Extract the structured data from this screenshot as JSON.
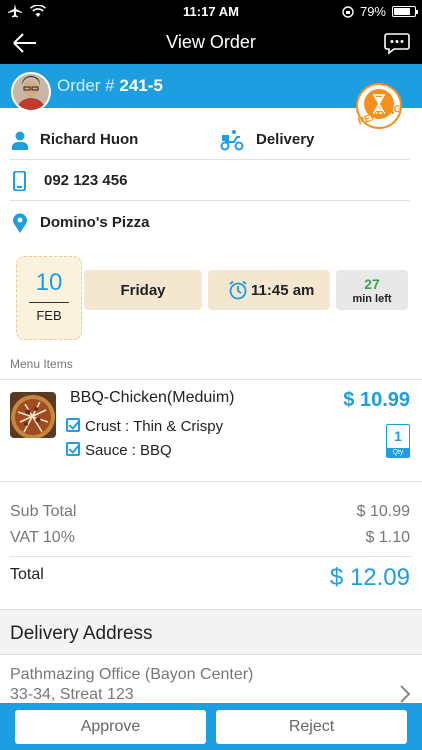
{
  "status_bar": {
    "time": "11:17 AM",
    "battery": "79%",
    "battery_level": 0.79
  },
  "nav": {
    "title": "View Order",
    "back_icon": "arrow-left-icon",
    "chat_icon": "chat-bubble-icon"
  },
  "order": {
    "label": "Order #",
    "number": "241-5",
    "status": "PENDING"
  },
  "customer": {
    "name": "Richard Huon",
    "phone": "092 123 456",
    "service": "Delivery",
    "store": "Domino's Pizza"
  },
  "schedule": {
    "day": "10",
    "month": "FEB",
    "weekday": "Friday",
    "time": "11:45 am",
    "minutes_left": "27",
    "minutes_label": "min  left"
  },
  "menu": {
    "section_label": "Menu Items",
    "items": [
      {
        "name": "BBQ-Chicken(Meduim)",
        "price": "$ 10.99",
        "options": [
          "Crust : Thin & Crispy",
          "Sauce : BBQ"
        ],
        "qty": "1",
        "qty_label": "Qty"
      }
    ]
  },
  "totals": {
    "subtotal_label": "Sub Total",
    "subtotal": "$ 10.99",
    "vat_label": "VAT 10%",
    "vat": "$ 1.10",
    "total_label": "Total",
    "total": "$ 12.09"
  },
  "delivery": {
    "heading": "Delivery Address",
    "line1": "Pathmazing Office (Bayon Center)",
    "line2": "33-34, Streat 123"
  },
  "actions": {
    "approve": "Approve",
    "reject": "Reject"
  },
  "colors": {
    "accent": "#1d9ee0",
    "pending": "#f5901e",
    "minutes": "#38a64a"
  }
}
